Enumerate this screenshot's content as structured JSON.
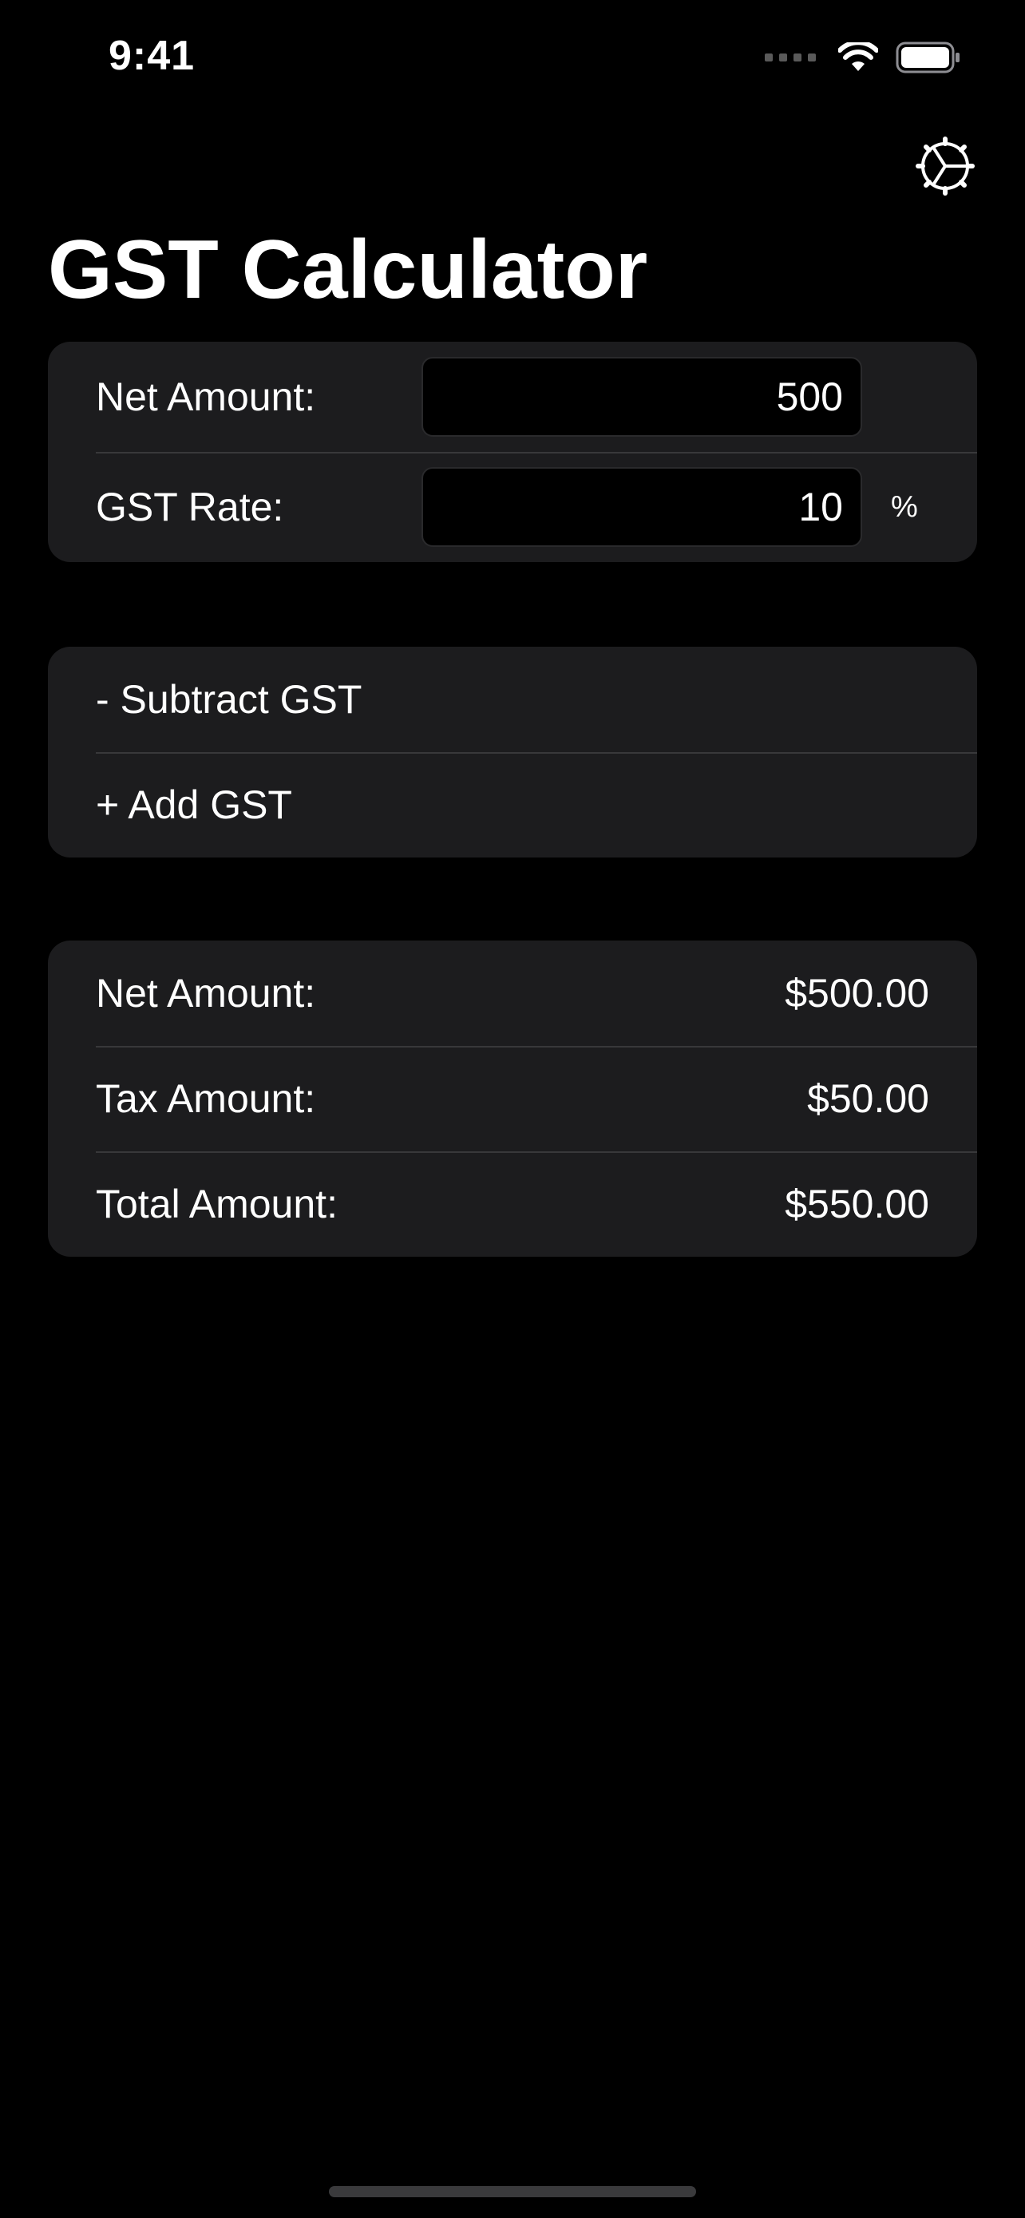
{
  "status_bar": {
    "time": "9:41",
    "signal_icon": "signal-dots-icon",
    "wifi_icon": "wifi-icon",
    "battery_icon": "battery-icon"
  },
  "header": {
    "settings_icon": "gear-icon",
    "title": "GST Calculator"
  },
  "inputs": {
    "net_amount_label": "Net Amount:",
    "net_amount_value": "500",
    "gst_rate_label": "GST Rate:",
    "gst_rate_value": "10",
    "gst_rate_unit": "%"
  },
  "actions": {
    "subtract_label": "- Subtract GST",
    "add_label": "+ Add GST"
  },
  "results": {
    "rows": [
      {
        "label": "Net Amount:",
        "value": "$500.00"
      },
      {
        "label": "Tax Amount:",
        "value": "$50.00"
      },
      {
        "label": "Total Amount:",
        "value": "$550.00"
      }
    ]
  },
  "colors": {
    "background": "#000000",
    "card": "#1c1c1e",
    "separator": "#38383a",
    "text": "#ffffff"
  }
}
